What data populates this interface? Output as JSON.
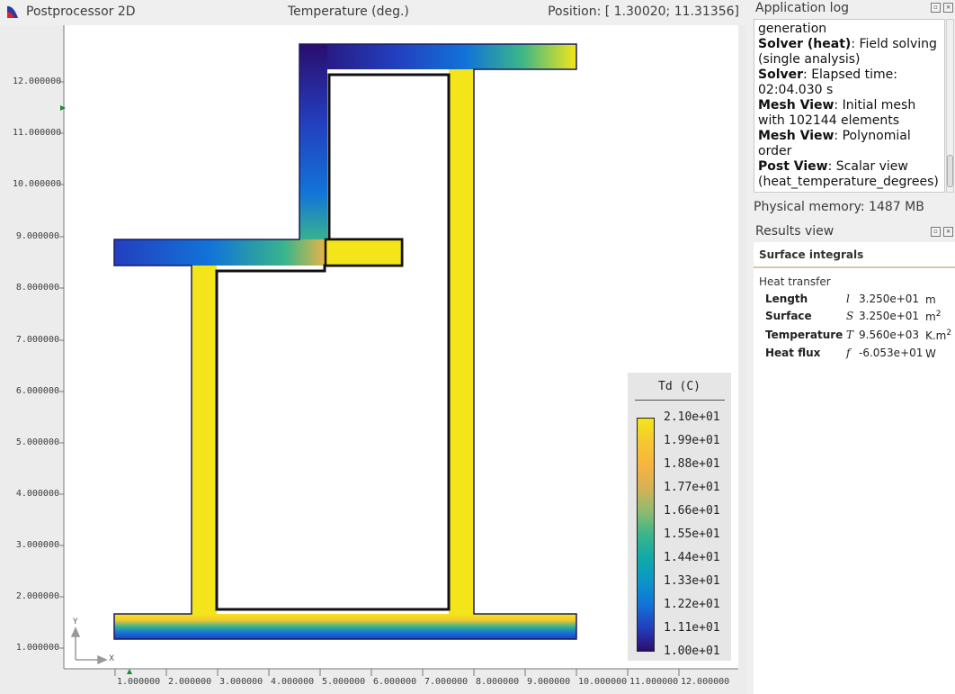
{
  "window": {
    "app_title": "Postprocessor 2D",
    "quantity": "Temperature (deg.)",
    "position": "Position: [ 1.30020; 11.31356]"
  },
  "plot": {
    "y_ticks": [
      "12.000000",
      "11.000000",
      "10.000000",
      "9.000000",
      "8.000000",
      "7.000000",
      "6.000000",
      "5.000000",
      "4.000000",
      "3.000000",
      "2.000000",
      "1.000000"
    ],
    "x_ticks": [
      "1.000000",
      "2.000000",
      "3.000000",
      "4.000000",
      "5.000000",
      "6.000000",
      "7.000000",
      "8.000000",
      "9.000000",
      "10.000000",
      "11.000000",
      "12.000000"
    ],
    "axis_x": "X",
    "axis_y": "Y"
  },
  "legend": {
    "title": "Td (C)",
    "values": [
      "2.10e+01",
      "1.99e+01",
      "1.88e+01",
      "1.77e+01",
      "1.66e+01",
      "1.55e+01",
      "1.44e+01",
      "1.33e+01",
      "1.22e+01",
      "1.11e+01",
      "1.00e+01"
    ]
  },
  "app_log": {
    "title": "Application log",
    "lines": [
      {
        "bold": "",
        "text": "generation"
      },
      {
        "bold": "Solver (heat)",
        "text": ": Field solving (single analysis)"
      },
      {
        "bold": "Solver",
        "text": ": Elapsed time: 02:04.030 s"
      },
      {
        "bold": "Mesh View",
        "text": ": Initial mesh with 102144 elements"
      },
      {
        "bold": "Mesh View",
        "text": ": Polynomial order"
      },
      {
        "bold": "Post View",
        "text": ": Scalar view (heat_temperature_degrees)"
      }
    ]
  },
  "memory": "Physical memory: 1487 MB",
  "results": {
    "title": "Results view",
    "header": "Surface integrals",
    "section": "Heat transfer",
    "rows": [
      {
        "name": "Length",
        "symbol": "l",
        "value": "3.250e+01",
        "unit": "m",
        "sup": ""
      },
      {
        "name": "Surface",
        "symbol": "S",
        "value": "3.250e+01",
        "unit": "m",
        "sup": "2"
      },
      {
        "name": "Temperature",
        "symbol": "T",
        "value": "9.560e+03",
        "unit": "K.m",
        "sup": "2"
      },
      {
        "name": "Heat flux",
        "symbol": "f",
        "value": "-6.053e+01",
        "unit": "W",
        "sup": ""
      }
    ]
  },
  "colors": {
    "hot": "#f3e51a",
    "cold": "#2a0d6e",
    "accent": "#1273d8"
  }
}
